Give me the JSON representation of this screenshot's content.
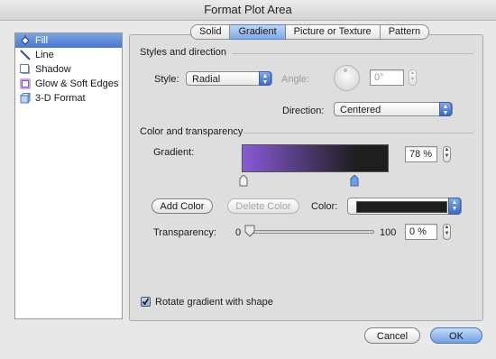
{
  "window": {
    "title": "Format Plot Area"
  },
  "sidebar": {
    "items": [
      {
        "label": "Fill",
        "icon": "paint-bucket-icon",
        "selected": true
      },
      {
        "label": "Line",
        "icon": "line-icon",
        "selected": false
      },
      {
        "label": "Shadow",
        "icon": "shadow-icon",
        "selected": false
      },
      {
        "label": "Glow & Soft Edges",
        "icon": "glow-icon",
        "selected": false
      },
      {
        "label": "3-D Format",
        "icon": "3d-format-icon",
        "selected": false
      }
    ]
  },
  "tabs": [
    {
      "label": "Solid",
      "active": false
    },
    {
      "label": "Gradient",
      "active": true
    },
    {
      "label": "Picture or Texture",
      "active": false
    },
    {
      "label": "Pattern",
      "active": false
    }
  ],
  "styles": {
    "section_title": "Styles and direction",
    "style_label": "Style:",
    "style_value": "Radial",
    "angle_label": "Angle:",
    "angle_value": "0°",
    "direction_label": "Direction:",
    "direction_value": "Centered"
  },
  "color": {
    "section_title": "Color and transparency",
    "gradient_label": "Gradient:",
    "gradient_percent": "78 %",
    "gradient_start_color": "#8a5ad8",
    "gradient_end_color": "#1e1e1e",
    "add_color_label": "Add Color",
    "delete_color_label": "Delete Color",
    "color_label": "Color:",
    "color_value": "#1e1e1e",
    "transparency_label": "Transparency:",
    "transparency_min": "0",
    "transparency_max": "100",
    "transparency_value": "0 %",
    "transparency_fraction": 0
  },
  "rotate": {
    "label": "Rotate gradient with shape",
    "checked": true
  },
  "footer": {
    "cancel_label": "Cancel",
    "ok_label": "OK"
  }
}
